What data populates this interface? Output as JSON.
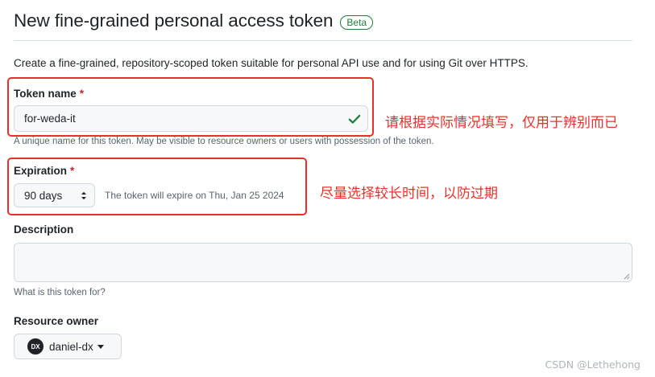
{
  "header": {
    "title": "New fine-grained personal access token",
    "badge": "Beta"
  },
  "intro": "Create a fine-grained, repository-scoped token suitable for personal API use and for using Git over HTTPS.",
  "token_name": {
    "label": "Token name",
    "required_mark": "*",
    "value": "for-weda-it",
    "hint": "A unique name for this token. May be visible to resource owners or users with possession of the token.",
    "valid_icon": "check-icon"
  },
  "expiration": {
    "label": "Expiration",
    "required_mark": "*",
    "selected": "90 days",
    "note": "The token will expire on Thu, Jan 25 2024",
    "arrow_icon": "select-arrows-icon"
  },
  "description": {
    "label": "Description",
    "value": "",
    "hint": "What is this token for?"
  },
  "resource_owner": {
    "label": "Resource owner",
    "avatar_text": "DX",
    "owner": "daniel-dx",
    "caret_icon": "caret-down-icon"
  },
  "annotations": {
    "token_name": "请根据实际情况填写，仅用于辨别而已",
    "expiration": "尽量选择较长时间，以防过期"
  },
  "watermark": "CSDN @Lethehong",
  "colors": {
    "success": "#1a7f37",
    "danger": "#cf222e",
    "annotation": "#e8302a",
    "border": "#d0d7de",
    "input_bg": "#f6f8fa"
  }
}
